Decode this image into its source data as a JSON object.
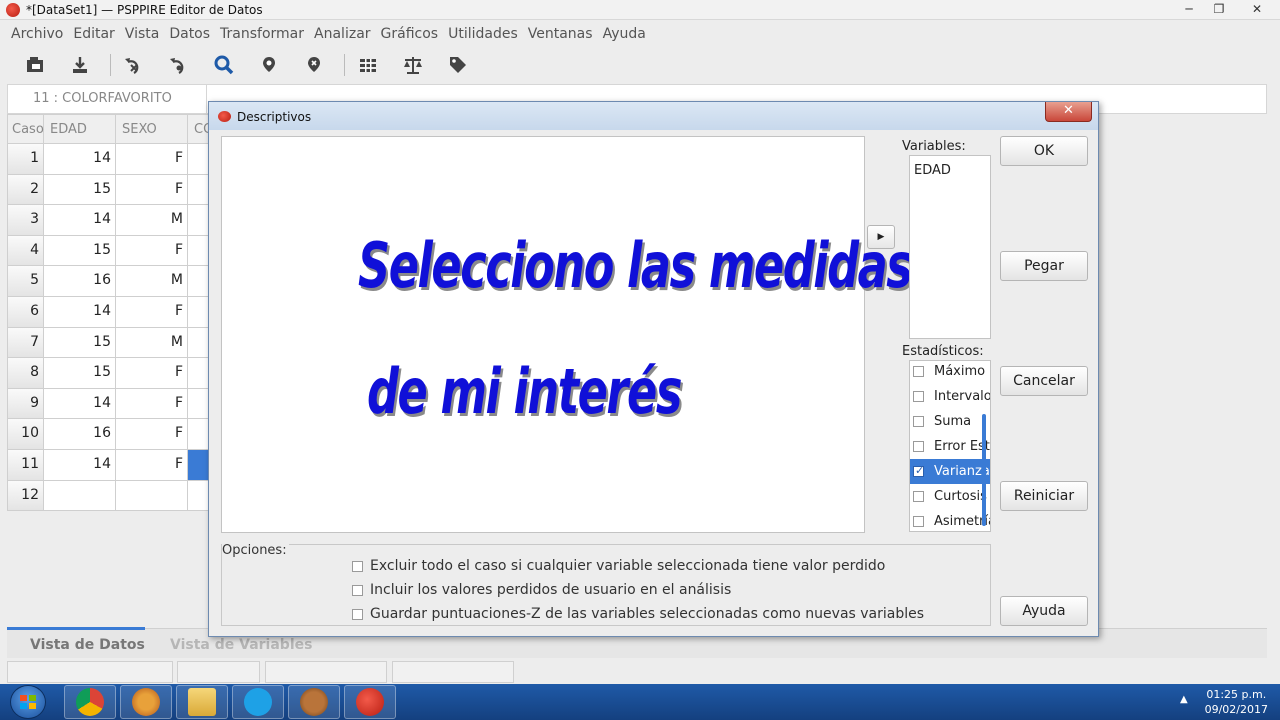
{
  "window": {
    "title": "*[DataSet1] — PSPPIRE Editor de Datos"
  },
  "menu": [
    "Archivo",
    "Editar",
    "Vista",
    "Datos",
    "Transformar",
    "Analizar",
    "Gráficos",
    "Utilidades",
    "Ventanas",
    "Ayuda"
  ],
  "toolbar_icons": [
    "open-icon",
    "save-icon",
    "goto-case-icon",
    "goto-variable-icon",
    "find-icon",
    "insert-case-icon",
    "insert-variable-icon",
    "split-file-icon",
    "weight-cases-icon",
    "value-labels-icon"
  ],
  "cell_ref": "11 : COLORFAVORITO",
  "grid": {
    "headers": [
      "Caso",
      "EDAD",
      "SEXO",
      "CO"
    ],
    "rows": [
      {
        "n": "1",
        "edad": "14",
        "sexo": "F"
      },
      {
        "n": "2",
        "edad": "15",
        "sexo": "F"
      },
      {
        "n": "3",
        "edad": "14",
        "sexo": "M"
      },
      {
        "n": "4",
        "edad": "15",
        "sexo": "F"
      },
      {
        "n": "5",
        "edad": "16",
        "sexo": "M"
      },
      {
        "n": "6",
        "edad": "14",
        "sexo": "F"
      },
      {
        "n": "7",
        "edad": "15",
        "sexo": "M"
      },
      {
        "n": "8",
        "edad": "15",
        "sexo": "F"
      },
      {
        "n": "9",
        "edad": "14",
        "sexo": "F"
      },
      {
        "n": "10",
        "edad": "16",
        "sexo": "F"
      },
      {
        "n": "11",
        "edad": "14",
        "sexo": "F"
      },
      {
        "n": "12",
        "edad": "",
        "sexo": ""
      }
    ]
  },
  "view_tabs": [
    "Vista de Datos",
    "Vista de Variables"
  ],
  "dialog": {
    "title": "Descriptivos",
    "overlay_line1": "Selecciono las medidas",
    "overlay_line2": "de mi interés",
    "variables_label": "Variables:",
    "variables": [
      "EDAD"
    ],
    "stats_label": "Estadísticos:",
    "stats": [
      {
        "label": "Máximo",
        "checked": false
      },
      {
        "label": "Intervalo",
        "checked": false
      },
      {
        "label": "Suma",
        "checked": false
      },
      {
        "label": "Error Estándar",
        "checked": false
      },
      {
        "label": "Varianza",
        "checked": true
      },
      {
        "label": "Curtosis",
        "checked": false
      },
      {
        "label": "Asimetría",
        "checked": false
      }
    ],
    "buttons": {
      "ok": "OK",
      "paste": "Pegar",
      "cancel": "Cancelar",
      "reset": "Reiniciar",
      "help": "Ayuda"
    },
    "options_label": "Opciones:",
    "options": [
      "Excluir todo el caso si cualquier variable seleccionada tiene valor perdido",
      "Incluir los valores perdidos de usuario en el análisis",
      "Guardar puntuaciones-Z de las variables seleccionadas como nuevas variables"
    ]
  },
  "taskbar": {
    "apps": [
      "chrome-icon",
      "firefox-icon",
      "file-explorer-icon",
      "skype-icon",
      "gimp-icon",
      "pspp-icon"
    ],
    "time": "01:25 p.m.",
    "date": "09/02/2017"
  }
}
